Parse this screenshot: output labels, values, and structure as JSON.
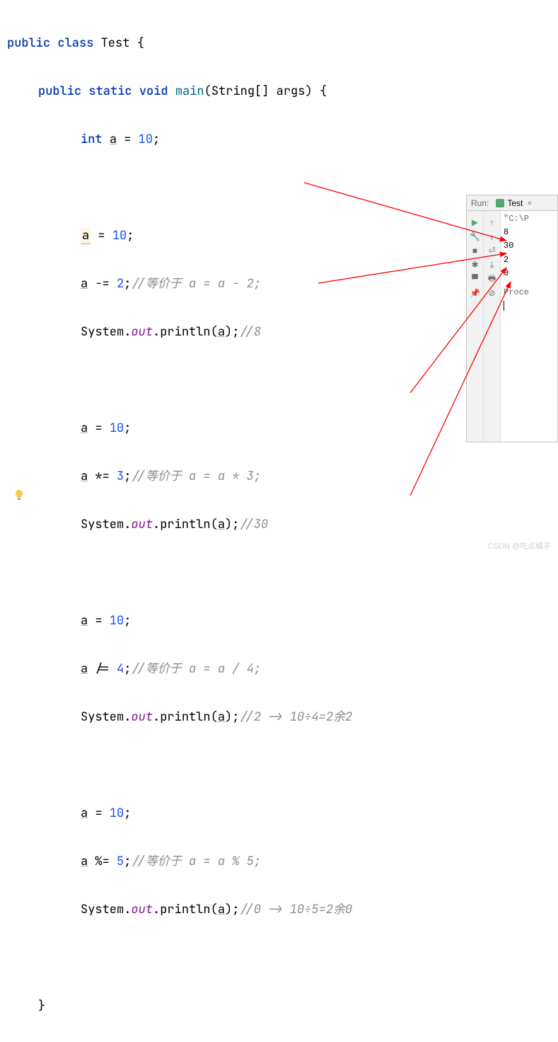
{
  "code": {
    "line1": {
      "kw1": "public",
      "kw2": "class",
      "cls": "Test",
      "brace": " {"
    },
    "line2": {
      "kw1": "public",
      "kw2": "static",
      "kw3": "void",
      "mtd": "main",
      "paren1": "(",
      "typ": "String",
      "arr": "[] ",
      "arg": "args",
      "paren2": ") {"
    },
    "line3": {
      "kw": "int",
      "var": "a",
      "eq": " = ",
      "num": "10",
      "semi": ";"
    },
    "line5": {
      "var": "a",
      "eq": " = ",
      "num": "10",
      "semi": ";"
    },
    "line6": {
      "var": "a",
      "op": " -= ",
      "num": "2",
      "semi": ";",
      "cmt": "//等价于 a = a - 2;"
    },
    "line7": {
      "sys": "System.",
      "out": "out",
      "dot": ".",
      "prn": "println",
      "p1": "(",
      "var": "a",
      "p2": ");",
      "cmt": "//8"
    },
    "line9": {
      "var": "a",
      "eq": " = ",
      "num": "10",
      "semi": ";"
    },
    "line10": {
      "var": "a",
      "op": " *= ",
      "num": "3",
      "semi": ";",
      "cmt": "//等价于 a = a * 3;"
    },
    "line11": {
      "sys": "System.",
      "out": "out",
      "dot": ".",
      "prn": "println",
      "p1": "(",
      "var": "a",
      "p2": ");",
      "cmt": "//30"
    },
    "line13": {
      "var": "a",
      "eq": " = ",
      "num": "10",
      "semi": ";"
    },
    "line14": {
      "var": "a",
      "op": " /= ",
      "num": "4",
      "semi": ";",
      "cmt": "//等价于 a = a / 4;"
    },
    "line15": {
      "sys": "System.",
      "out": "out",
      "dot": ".",
      "prn": "println",
      "p1": "(",
      "var": "a",
      "p2": ");",
      "cmt": "//2 -> 10÷4=2余2"
    },
    "line17": {
      "var": "a",
      "eq": " = ",
      "num": "10",
      "semi": ";"
    },
    "line18": {
      "var": "a",
      "op": " %= ",
      "num": "5",
      "semi": ";",
      "cmt": "//等价于 a = a % 5;"
    },
    "line19": {
      "sys": "System.",
      "out": "out",
      "dot": ".",
      "prn": "println",
      "p1": "(",
      "var": "a",
      "p2": ");",
      "cmt": "//0 -> 10÷5=2余0"
    },
    "close1": "}"
  },
  "run": {
    "label": "Run:",
    "tab": "Test",
    "tabclose": "×",
    "output": {
      "path": "\"C:\\P",
      "v1": "8",
      "v2": "30",
      "v3": "2",
      "v4": "0",
      "proc": "Proce"
    }
  },
  "watermark": "CSDN @吃点橘子"
}
